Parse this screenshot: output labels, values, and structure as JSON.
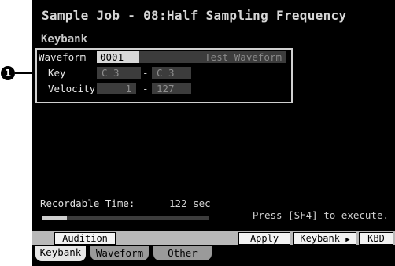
{
  "header": {
    "title": "Sample Job - 08:Half Sampling Frequency"
  },
  "section": {
    "title": "Keybank"
  },
  "callout": {
    "number": "1"
  },
  "params": {
    "waveform": {
      "label": "Waveform",
      "value": "0001",
      "name": "Test Waveform"
    },
    "key": {
      "label": "Key",
      "low": "C  3",
      "high": "C  3",
      "separator": "-"
    },
    "velocity": {
      "label": "Velocity",
      "low": "1",
      "high": "127",
      "separator": "-"
    }
  },
  "recordable": {
    "label": "Recordable Time:",
    "value": "122 sec",
    "progress": 0.15
  },
  "hint": "Press [SF4] to execute.",
  "function_buttons": {
    "audition": "Audition",
    "apply": "Apply",
    "keybank": "Keybank",
    "kbd": "KBD"
  },
  "tabs": {
    "keybank": "Keybank",
    "waveform": "Waveform",
    "other": "Other",
    "active": "keybank"
  },
  "colors": {
    "screen_bg": "#000000",
    "text": "#e0e0e0",
    "selected_field": "#d8d8d8",
    "inactive_field": "#3c3c3c"
  }
}
